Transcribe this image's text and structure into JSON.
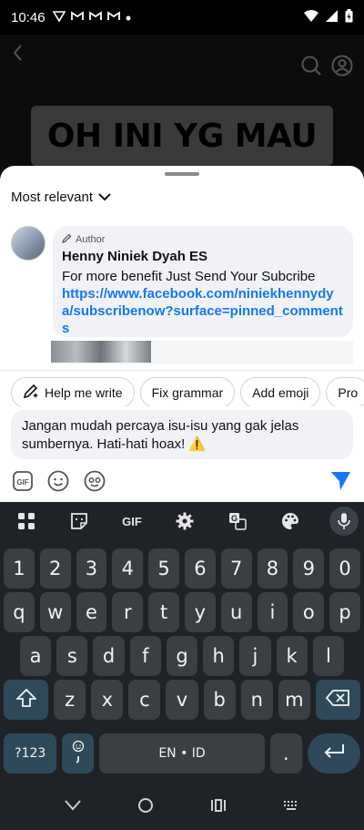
{
  "status": {
    "time": "10:46",
    "notification_icons": [
      "vpn-icon",
      "gmail-icon",
      "gmail-icon",
      "gmail-icon",
      "dot-icon"
    ],
    "right_icons": [
      "wifi-icon",
      "signal-icon",
      "battery-icon"
    ]
  },
  "video": {
    "caption": "OH INI YG MAU"
  },
  "sheet": {
    "sort_label": "Most relevant",
    "comment": {
      "author_badge": "Author",
      "author_name": "Henny Niniek Dyah ES",
      "text": "For more benefit Just Send Your Subcribe",
      "link": "https://www.facebook.com/niniekhennydya/subscribenow?surface=pinned_comments"
    },
    "chips": [
      "Help me write",
      "Fix grammar",
      "Add emoji",
      "Pro"
    ],
    "input_text": "Jangan mudah percaya isu-isu yang gak jelas sumbernya. Hati-hati hoax! ⚠️"
  },
  "keyboard": {
    "toolbar": {
      "gif_label": "GIF"
    },
    "row1": [
      "1",
      "2",
      "3",
      "4",
      "5",
      "6",
      "7",
      "8",
      "9",
      "0"
    ],
    "row2": [
      "q",
      "w",
      "e",
      "r",
      "t",
      "y",
      "u",
      "i",
      "o",
      "p"
    ],
    "row3": [
      "a",
      "s",
      "d",
      "f",
      "g",
      "h",
      "j",
      "k",
      "l"
    ],
    "row4": [
      "z",
      "x",
      "c",
      "v",
      "b",
      "n",
      "m"
    ],
    "symbols_label": "?123",
    "space_label": "EN • ID",
    "period_label": "."
  },
  "colors": {
    "link": "#1877f2",
    "send": "#1877f2",
    "keyboard_bg": "#1f2327"
  }
}
